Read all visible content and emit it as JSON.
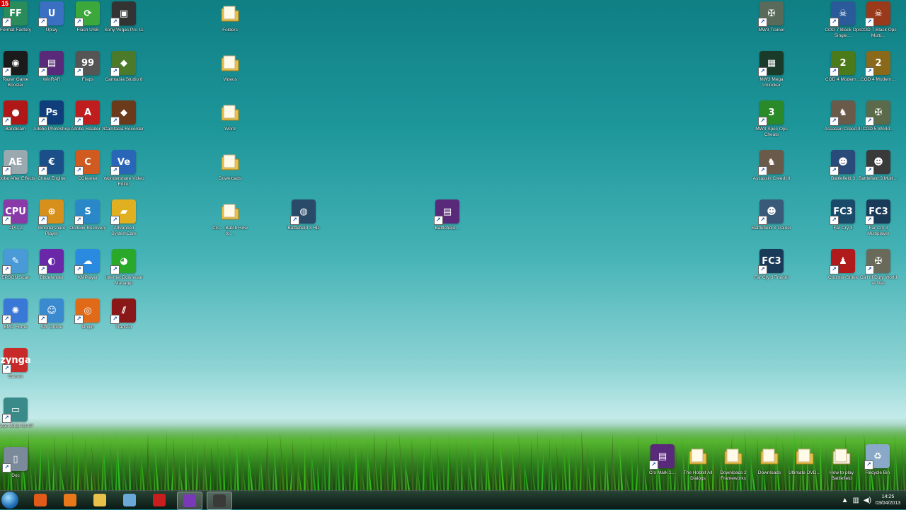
{
  "recording_badge": "15",
  "left_icons": [
    {
      "label": "Format Factory",
      "glyph": "FF",
      "color": "#2a8c5a"
    },
    {
      "label": "Uplay",
      "glyph": "U",
      "color": "#3a6fc2"
    },
    {
      "label": "Flash USB",
      "glyph": "⟳",
      "color": "#3ca83c"
    },
    {
      "label": "Sony Vegas Pro 11",
      "glyph": "▣",
      "color": "#333333"
    },
    {
      "label": "Razer Game Booster",
      "glyph": "◉",
      "color": "#1b1b1b"
    },
    {
      "label": "WinRAR",
      "glyph": "▤",
      "color": "#5a2a7a"
    },
    {
      "label": "Fraps",
      "glyph": "99",
      "color": "#555555"
    },
    {
      "label": "Camtasia Studio 8",
      "glyph": "◆",
      "color": "#4a7a2a"
    },
    {
      "label": "Bandicam",
      "glyph": "●",
      "color": "#b01818"
    },
    {
      "label": "Adobe Photoshop",
      "glyph": "Ps",
      "color": "#0f3e7a"
    },
    {
      "label": "Adobe Reader X",
      "glyph": "A",
      "color": "#c01e1e"
    },
    {
      "label": "Camtasia Recorder",
      "glyph": "◆",
      "color": "#6a3a1a"
    },
    {
      "label": "Adobe After Effects",
      "glyph": "AE",
      "color": "#9aa8b0"
    },
    {
      "label": "Cheat Engine",
      "glyph": "€",
      "color": "#1a4f8a"
    },
    {
      "label": "CCleaner",
      "glyph": "C",
      "color": "#d05a20"
    },
    {
      "label": "Wondershare Video Editor",
      "glyph": "Ve",
      "color": "#2a66b8"
    },
    {
      "label": "CPU-Z",
      "glyph": "CPU",
      "color": "#8a3aa8"
    },
    {
      "label": "Wondershare Player",
      "glyph": "⊕",
      "color": "#d8901c"
    },
    {
      "label": "Outlook Recovery",
      "glyph": "S",
      "color": "#2a88c8"
    },
    {
      "label": "Advanced SystemCare",
      "glyph": "▰",
      "color": "#e0b020"
    },
    {
      "label": "EPSON Scan",
      "glyph": "✎",
      "color": "#4a9ad8"
    },
    {
      "label": "Bitdefender",
      "glyph": "◐",
      "color": "#6a28a8"
    },
    {
      "label": "KMPlayer",
      "glyph": "☁",
      "color": "#2a8ae0"
    },
    {
      "label": "Internet Download Manager",
      "glyph": "◕",
      "color": "#2aa82a"
    },
    {
      "label": "EMC Home",
      "glyph": "✺",
      "color": "#3a78d8"
    },
    {
      "label": "SW Online",
      "glyph": "☺",
      "color": "#3a8ad0"
    },
    {
      "label": "Origin",
      "glyph": "◎",
      "color": "#e06a18"
    },
    {
      "label": "Transfer",
      "glyph": "⫽",
      "color": "#8a1818"
    },
    {
      "label": "Games",
      "glyph": "zynga",
      "color": "#c82a2a"
    },
    {
      "label": "Scan 2013-03-07",
      "glyph": "▭",
      "color": "#3a8a8a"
    },
    {
      "label": "Doc",
      "glyph": "▯",
      "color": "#7a8a9a"
    }
  ],
  "mid_icons": [
    {
      "label": "Folders",
      "glyph": "",
      "color": "#e8c04a",
      "folder": true
    },
    {
      "label": "Videos",
      "glyph": "",
      "color": "#e8c04a",
      "folder": true
    },
    {
      "label": "Word",
      "glyph": "",
      "color": "#e8c04a",
      "folder": true
    },
    {
      "label": "Downloads",
      "glyph": "",
      "color": "#e8c04a",
      "folder": true
    },
    {
      "label": "Crs… Batch How to…",
      "glyph": "",
      "color": "#e8c04a",
      "folder": true
    },
    {
      "label": "Battlefield 3 HD",
      "glyph": "◍",
      "color": "#2a4a6a"
    },
    {
      "label": "Battlefield…",
      "glyph": "▤",
      "color": "#5a2a7a"
    }
  ],
  "right_icons": [
    {
      "label": "MW3 Trainer",
      "glyph": "✠",
      "color": "#5a6a5a"
    },
    {
      "label": "COD 7 Black Ops Single…",
      "glyph": "☠",
      "color": "#2a5a9a"
    },
    {
      "label": "COD 7 Black Ops Multi…",
      "glyph": "☠",
      "color": "#9a3a1a"
    },
    {
      "label": "MW3 Mega Unlocker",
      "glyph": "▦",
      "color": "#1a3a2a"
    },
    {
      "label": "COD 4 Modern…",
      "glyph": "2",
      "color": "#4a7a1a"
    },
    {
      "label": "COD 4 Modern…",
      "glyph": "2",
      "color": "#8a6a1a"
    },
    {
      "label": "MW3 Spec Ops Cheats",
      "glyph": "3",
      "color": "#2a8a2a"
    },
    {
      "label": "Assassin Creed III",
      "glyph": "♞",
      "color": "#6a5a4a"
    },
    {
      "label": "COD 5 World…",
      "glyph": "✠",
      "color": "#5a6a4a"
    },
    {
      "label": "Assassin Creed III",
      "glyph": "♞",
      "color": "#6a5a4a"
    },
    {
      "label": "Battlefield 3",
      "glyph": "☻",
      "color": "#2a4a7a"
    },
    {
      "label": "Battlefield 3 Multi…",
      "glyph": "☻",
      "color": "#3a3a3a"
    },
    {
      "label": "Battlefield 3 Trainer",
      "glyph": "☻",
      "color": "#3a5a7a"
    },
    {
      "label": "Far Cry 3",
      "glyph": "FC3",
      "color": "#1a4a6a"
    },
    {
      "label": "Far Cry 3 Multiplayer",
      "glyph": "FC3",
      "color": "#1a3a5a"
    },
    {
      "label": "Far Cry 3 Trainer",
      "glyph": "FC3",
      "color": "#1a3a5a"
    },
    {
      "label": "Counter-Strike",
      "glyph": "♟",
      "color": "#b01a1a"
    },
    {
      "label": "Call of Duty World at War",
      "glyph": "✠",
      "color": "#6a6a5a"
    }
  ],
  "bottom_icons": [
    {
      "label": "Crs Mark 1…",
      "glyph": "▤",
      "color": "#5a2a7a"
    },
    {
      "label": "The Hobbit All Dialogs",
      "glyph": "",
      "color": "#e8c04a",
      "folder": true
    },
    {
      "label": "Downloads 2 Frameworks",
      "glyph": "",
      "color": "#e8c04a",
      "folder": true
    },
    {
      "label": "Downloads",
      "glyph": "",
      "color": "#e8c04a",
      "folder": true
    },
    {
      "label": "Ultimate DVD…",
      "glyph": "",
      "color": "#e8c04a",
      "folder": true
    },
    {
      "label": "How to play Battlefield",
      "glyph": "",
      "color": "#f4f4f4",
      "folder": true
    },
    {
      "label": "Recycle Bin",
      "glyph": "♻",
      "color": "#8aa8c8"
    }
  ],
  "taskbar": {
    "pinned": [
      {
        "name": "chrome",
        "color": "#e05a1a"
      },
      {
        "name": "firefox",
        "color": "#e8781a"
      },
      {
        "name": "explorer",
        "color": "#e8c04a"
      },
      {
        "name": "control-panel",
        "color": "#6aa8d8"
      },
      {
        "name": "adobe-reader",
        "color": "#c81e1e"
      },
      {
        "name": "bitdefender",
        "color": "#7a3ab8"
      },
      {
        "name": "vegas",
        "color": "#3a3a3a"
      }
    ],
    "clock_time": "14:25",
    "clock_date": "03/04/2013"
  }
}
